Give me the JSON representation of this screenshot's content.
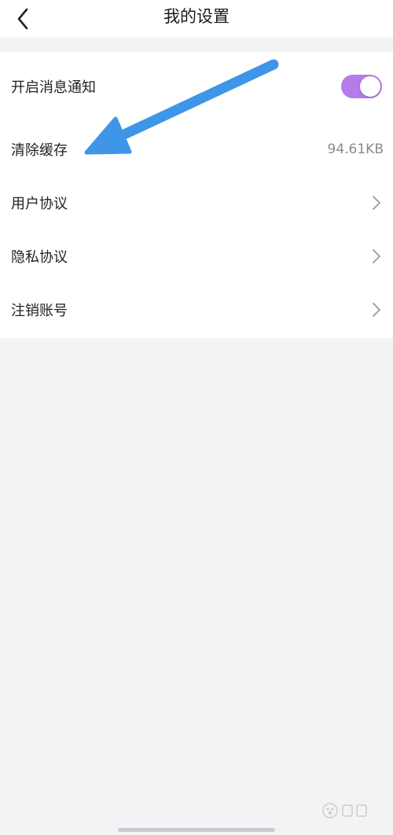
{
  "header": {
    "title": "我的设置"
  },
  "settings": {
    "items": [
      {
        "label": "开启消息通知",
        "type": "toggle",
        "enabled": true
      },
      {
        "label": "清除缓存",
        "type": "value",
        "value": "94.61KB"
      },
      {
        "label": "用户协议",
        "type": "link"
      },
      {
        "label": "隐私协议",
        "type": "link"
      },
      {
        "label": "注销账号",
        "type": "link"
      }
    ]
  },
  "colors": {
    "toggle_on": "#b57be8",
    "annotation_arrow": "#3f95e8",
    "page_background": "#f2f3f5"
  },
  "icons": {
    "back": "chevron-left-icon",
    "row_arrow": "chevron-right-icon"
  }
}
